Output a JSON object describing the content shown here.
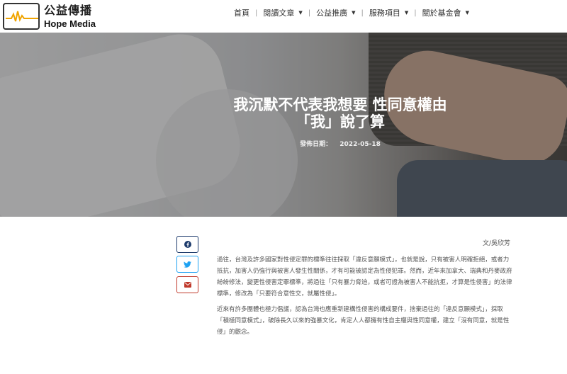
{
  "site": {
    "logo_cn": "公益傳播",
    "logo_en": "Hope Media"
  },
  "nav": {
    "items": [
      {
        "label": "首頁",
        "has_dropdown": false
      },
      {
        "label": "閱讀文章",
        "has_dropdown": true
      },
      {
        "label": "公益推廣",
        "has_dropdown": true
      },
      {
        "label": "服務項目",
        "has_dropdown": true
      },
      {
        "label": "關於基金會",
        "has_dropdown": true
      }
    ],
    "separator": "|"
  },
  "hero": {
    "title_line1": "我沉默不代表我想要 性同意權由",
    "title_line2": "「我」說了算",
    "date_label": "發佈日期：",
    "date_value": "2022-05-18"
  },
  "share": {
    "facebook_icon": "facebook-icon",
    "twitter_icon": "twitter-icon",
    "email_icon": "email-icon",
    "colors": {
      "facebook": "#1c3a6b",
      "twitter": "#1da1f2",
      "email": "#c0392b"
    }
  },
  "article": {
    "author": "文/吳欣芳",
    "paragraphs": [
      "過往，台灣及許多國家對性侵定罪的標準往往採取「違反意願模式」，也就是說，只有被害人明確拒絕，或者力抵抗，加害人仍強行與被害人發生性關係，才有可能被認定為性侵犯罪。然而，近年來加拿大、瑞典和丹麥政府紛紛修法，變更性侵害定罪標準，將過往「只有暴力脅迫，或者可證為被害人不能抗拒，才算是性侵害」的法律標準，修改為「只要符合意性交，就屬性侵」。",
      "近來有許多團體也極力倡議，認為台灣也應重新建構性侵害的構成要件，捨棄過往的「違反意願模式」，採取「積極同意模式」，破除長久以來的強暴文化，肯定人人都擁有性自主權與性同意權，建立「沒有同意，就是性侵」的觀念。"
    ]
  }
}
